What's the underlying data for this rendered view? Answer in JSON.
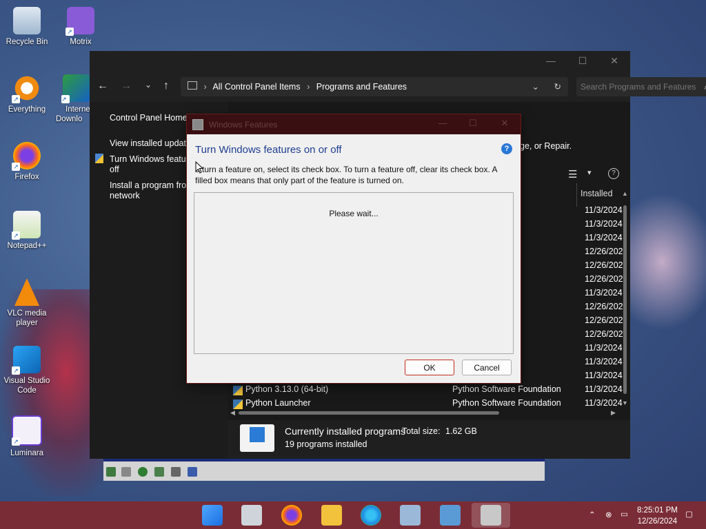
{
  "desktop_icons": [
    {
      "label": "Recycle Bin",
      "icon": "recycle-bin-icon"
    },
    {
      "label": "Motrix",
      "icon": "motrix-icon"
    },
    {
      "label": "Everything",
      "icon": "everything-icon"
    },
    {
      "label": "Interne Downlo",
      "icon": "idm-icon"
    },
    {
      "label": "Firefox",
      "icon": "firefox-icon"
    },
    {
      "label": "Notepad++",
      "icon": "notepadpp-icon"
    },
    {
      "label": "VLC media player",
      "icon": "vlc-icon"
    },
    {
      "label": "Visual Studio Code",
      "icon": "vscode-icon"
    },
    {
      "label": "Luminara",
      "icon": "luminara-icon"
    }
  ],
  "control_panel": {
    "breadcrumb": [
      "All Control Panel Items",
      "Programs and Features"
    ],
    "search_placeholder": "Search Programs and Features",
    "left_nav": {
      "home": "Control Panel Home",
      "view_updates": "View installed update",
      "turn_features": "Turn Windows featur",
      "turn_features_2": "off",
      "install_program": "Install a program fron",
      "install_program_2": "network"
    },
    "subtitle_tail": "ge, or Repair.",
    "column_installed": "Installed",
    "rows": [
      {
        "name": "",
        "publisher": "",
        "date": "11/3/2024"
      },
      {
        "name": "",
        "publisher": "",
        "date": "11/3/2024"
      },
      {
        "name": "",
        "publisher": "",
        "date": "11/3/2024"
      },
      {
        "name": "",
        "publisher": "",
        "date": "12/26/202"
      },
      {
        "name": "",
        "publisher": "",
        "date": "12/26/202"
      },
      {
        "name": "",
        "publisher": "ation",
        "date": "12/26/202"
      },
      {
        "name": "",
        "publisher": "ation",
        "date": "11/3/2024"
      },
      {
        "name": "",
        "publisher": "ation",
        "date": "12/26/202"
      },
      {
        "name": "",
        "publisher": "",
        "date": "12/26/202"
      },
      {
        "name": "",
        "publisher": "",
        "date": "12/26/202"
      },
      {
        "name": "",
        "publisher": "",
        "date": "11/3/2024"
      },
      {
        "name": "",
        "publisher": "",
        "date": "11/3/2024"
      },
      {
        "name": "",
        "publisher": "ation",
        "date": "11/3/2024"
      },
      {
        "name": "Python 3.13.0 (64-bit)",
        "publisher": "Python Software Foundation",
        "date": "11/3/2024"
      },
      {
        "name": "Python Launcher",
        "publisher": "Python Software Foundation",
        "date": "11/3/2024"
      }
    ],
    "status": {
      "title": "Currently installed programs",
      "total_label": "Total size:",
      "total_value": "1.62 GB",
      "count": "19 programs installed"
    }
  },
  "dialog": {
    "title": "Windows Features",
    "heading": "Turn Windows features on or off",
    "description": "o turn a feature on, select its check box. To turn a feature off, clear its check box. A filled box means that only part of the feature is turned on.",
    "wait_text": "Please wait...",
    "ok": "OK",
    "cancel": "Cancel"
  },
  "taskbar": {
    "time": "8:25:01 PM",
    "date": "12/26/2024"
  },
  "colors": {
    "taskbar": "#7a2c36",
    "dialog_heading": "#1e3d8f",
    "ok_border": "#c42b1c"
  }
}
